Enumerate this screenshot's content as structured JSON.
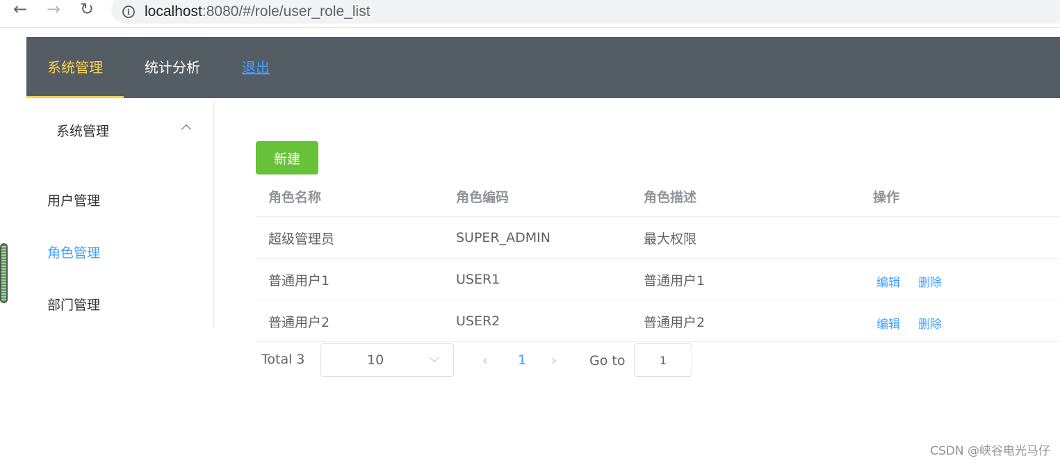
{
  "browser": {
    "url_host": "localhost",
    "url_rest": ":8080/#/role/user_role_list"
  },
  "top_menu": [
    {
      "label": "系统管理",
      "active": true
    },
    {
      "label": "统计分析",
      "active": false
    },
    {
      "label": "退出",
      "link": true
    }
  ],
  "sidebar": {
    "submenu_title": "系统管理",
    "items": [
      {
        "label": "用户管理"
      },
      {
        "label": "角色管理",
        "active": true
      },
      {
        "label": "部门管理"
      }
    ]
  },
  "toolbar": {
    "new_label": "新建"
  },
  "table": {
    "headers": [
      "角色名称",
      "角色编码",
      "角色描述",
      "操作"
    ],
    "rows": [
      {
        "name": "超级管理员",
        "code": "SUPER_ADMIN",
        "desc": "最大权限",
        "ops": []
      },
      {
        "name": "普通用户1",
        "code": "USER1",
        "desc": "普通用户1",
        "ops": [
          "编辑",
          "删除"
        ]
      },
      {
        "name": "普通用户2",
        "code": "USER2",
        "desc": "普通用户2",
        "ops": [
          "编辑",
          "删除"
        ]
      }
    ]
  },
  "pagination": {
    "total": "Total 3",
    "page_size": "10",
    "current_page": "1",
    "goto_label": "Go to",
    "goto_value": "1"
  },
  "watermark": "CSDN @峡谷电光马仔",
  "colors": {
    "nav_bg": "#545c64",
    "nav_active": "#ffd04b",
    "primary": "#409eff",
    "success": "#67c23a"
  }
}
